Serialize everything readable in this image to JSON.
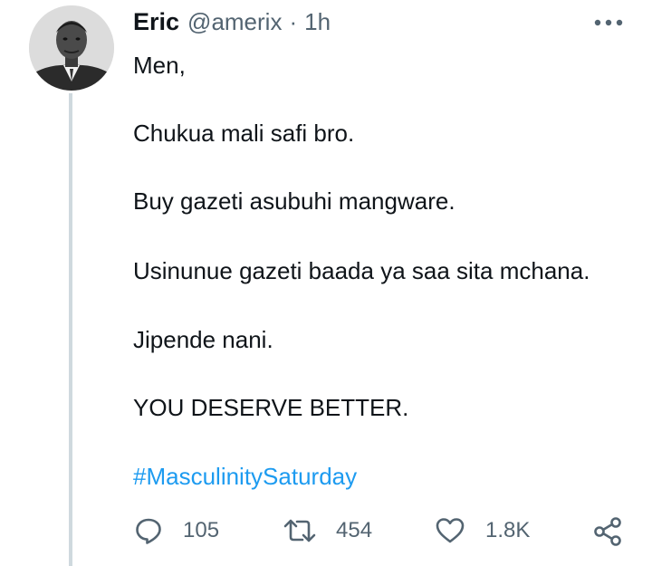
{
  "tweet": {
    "author": {
      "name": "Eric",
      "handle": "@amerix",
      "separator": "·",
      "time": "1h",
      "avatar_icon": "profile-photo"
    },
    "body": [
      "Men,",
      "Chukua mali safi bro.",
      "Buy gazeti asubuhi mangware.",
      "Usinunue gazeti baada ya saa sita mchana.",
      "Jipende nani.",
      "YOU DESERVE BETTER."
    ],
    "hashtag": "#MasculinitySaturday",
    "actions": {
      "reply": {
        "icon": "reply-icon",
        "count": "105"
      },
      "retweet": {
        "icon": "retweet-icon",
        "count": "454"
      },
      "like": {
        "icon": "heart-icon",
        "count": "1.8K"
      },
      "share": {
        "icon": "share-icon"
      }
    },
    "more_icon": "more-options-icon"
  },
  "colors": {
    "text": "#0f1419",
    "secondary": "#536471",
    "link": "#1d9bf0",
    "thread_line": "#cfd9de"
  }
}
